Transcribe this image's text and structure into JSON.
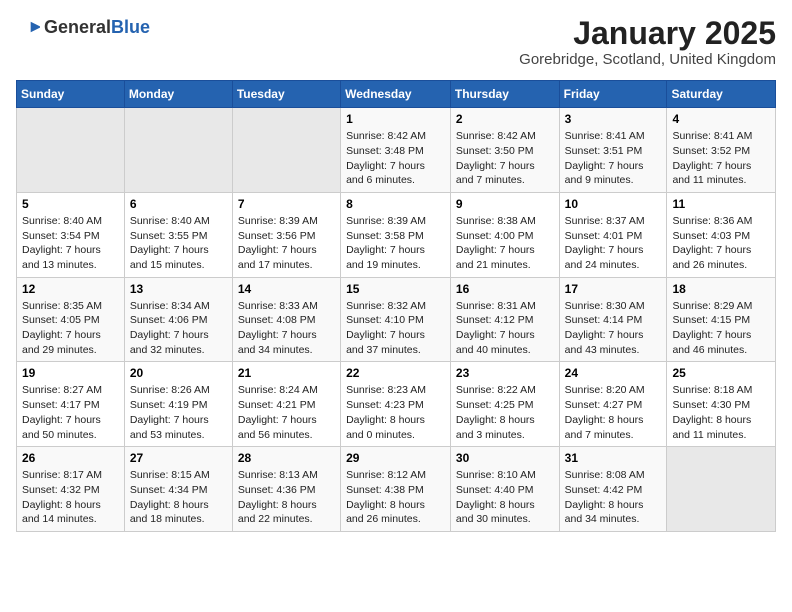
{
  "logo": {
    "general": "General",
    "blue": "Blue"
  },
  "header": {
    "month": "January 2025",
    "location": "Gorebridge, Scotland, United Kingdom"
  },
  "weekdays": [
    "Sunday",
    "Monday",
    "Tuesday",
    "Wednesday",
    "Thursday",
    "Friday",
    "Saturday"
  ],
  "weeks": [
    [
      {
        "day": "",
        "empty": true
      },
      {
        "day": "",
        "empty": true
      },
      {
        "day": "",
        "empty": true
      },
      {
        "day": "1",
        "sunrise": "8:42 AM",
        "sunset": "3:48 PM",
        "daylight": "7 hours and 6 minutes."
      },
      {
        "day": "2",
        "sunrise": "8:42 AM",
        "sunset": "3:50 PM",
        "daylight": "7 hours and 7 minutes."
      },
      {
        "day": "3",
        "sunrise": "8:41 AM",
        "sunset": "3:51 PM",
        "daylight": "7 hours and 9 minutes."
      },
      {
        "day": "4",
        "sunrise": "8:41 AM",
        "sunset": "3:52 PM",
        "daylight": "7 hours and 11 minutes."
      }
    ],
    [
      {
        "day": "5",
        "sunrise": "8:40 AM",
        "sunset": "3:54 PM",
        "daylight": "7 hours and 13 minutes."
      },
      {
        "day": "6",
        "sunrise": "8:40 AM",
        "sunset": "3:55 PM",
        "daylight": "7 hours and 15 minutes."
      },
      {
        "day": "7",
        "sunrise": "8:39 AM",
        "sunset": "3:56 PM",
        "daylight": "7 hours and 17 minutes."
      },
      {
        "day": "8",
        "sunrise": "8:39 AM",
        "sunset": "3:58 PM",
        "daylight": "7 hours and 19 minutes."
      },
      {
        "day": "9",
        "sunrise": "8:38 AM",
        "sunset": "4:00 PM",
        "daylight": "7 hours and 21 minutes."
      },
      {
        "day": "10",
        "sunrise": "8:37 AM",
        "sunset": "4:01 PM",
        "daylight": "7 hours and 24 minutes."
      },
      {
        "day": "11",
        "sunrise": "8:36 AM",
        "sunset": "4:03 PM",
        "daylight": "7 hours and 26 minutes."
      }
    ],
    [
      {
        "day": "12",
        "sunrise": "8:35 AM",
        "sunset": "4:05 PM",
        "daylight": "7 hours and 29 minutes."
      },
      {
        "day": "13",
        "sunrise": "8:34 AM",
        "sunset": "4:06 PM",
        "daylight": "7 hours and 32 minutes."
      },
      {
        "day": "14",
        "sunrise": "8:33 AM",
        "sunset": "4:08 PM",
        "daylight": "7 hours and 34 minutes."
      },
      {
        "day": "15",
        "sunrise": "8:32 AM",
        "sunset": "4:10 PM",
        "daylight": "7 hours and 37 minutes."
      },
      {
        "day": "16",
        "sunrise": "8:31 AM",
        "sunset": "4:12 PM",
        "daylight": "7 hours and 40 minutes."
      },
      {
        "day": "17",
        "sunrise": "8:30 AM",
        "sunset": "4:14 PM",
        "daylight": "7 hours and 43 minutes."
      },
      {
        "day": "18",
        "sunrise": "8:29 AM",
        "sunset": "4:15 PM",
        "daylight": "7 hours and 46 minutes."
      }
    ],
    [
      {
        "day": "19",
        "sunrise": "8:27 AM",
        "sunset": "4:17 PM",
        "daylight": "7 hours and 50 minutes."
      },
      {
        "day": "20",
        "sunrise": "8:26 AM",
        "sunset": "4:19 PM",
        "daylight": "7 hours and 53 minutes."
      },
      {
        "day": "21",
        "sunrise": "8:24 AM",
        "sunset": "4:21 PM",
        "daylight": "7 hours and 56 minutes."
      },
      {
        "day": "22",
        "sunrise": "8:23 AM",
        "sunset": "4:23 PM",
        "daylight": "8 hours and 0 minutes."
      },
      {
        "day": "23",
        "sunrise": "8:22 AM",
        "sunset": "4:25 PM",
        "daylight": "8 hours and 3 minutes."
      },
      {
        "day": "24",
        "sunrise": "8:20 AM",
        "sunset": "4:27 PM",
        "daylight": "8 hours and 7 minutes."
      },
      {
        "day": "25",
        "sunrise": "8:18 AM",
        "sunset": "4:30 PM",
        "daylight": "8 hours and 11 minutes."
      }
    ],
    [
      {
        "day": "26",
        "sunrise": "8:17 AM",
        "sunset": "4:32 PM",
        "daylight": "8 hours and 14 minutes."
      },
      {
        "day": "27",
        "sunrise": "8:15 AM",
        "sunset": "4:34 PM",
        "daylight": "8 hours and 18 minutes."
      },
      {
        "day": "28",
        "sunrise": "8:13 AM",
        "sunset": "4:36 PM",
        "daylight": "8 hours and 22 minutes."
      },
      {
        "day": "29",
        "sunrise": "8:12 AM",
        "sunset": "4:38 PM",
        "daylight": "8 hours and 26 minutes."
      },
      {
        "day": "30",
        "sunrise": "8:10 AM",
        "sunset": "4:40 PM",
        "daylight": "8 hours and 30 minutes."
      },
      {
        "day": "31",
        "sunrise": "8:08 AM",
        "sunset": "4:42 PM",
        "daylight": "8 hours and 34 minutes."
      },
      {
        "day": "",
        "empty": true
      }
    ]
  ]
}
